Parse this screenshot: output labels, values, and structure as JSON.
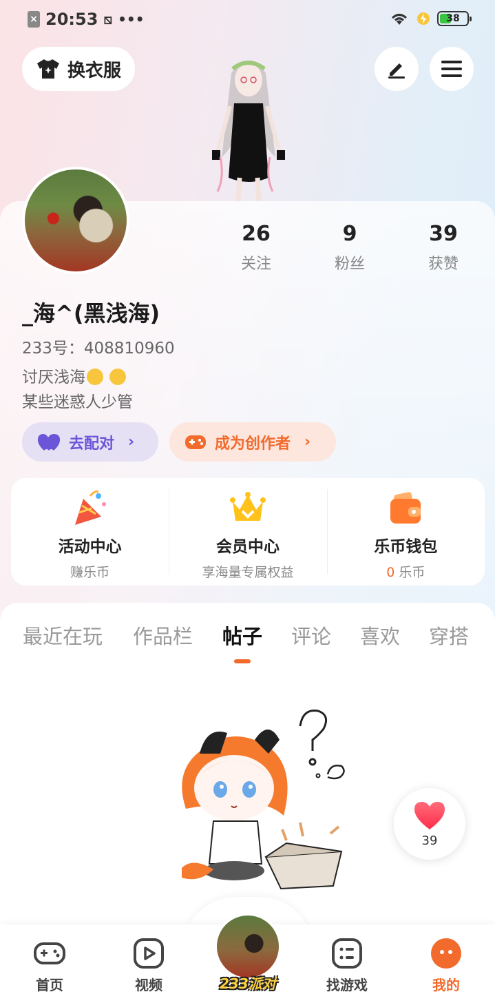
{
  "status_bar": {
    "time": "20:53",
    "battery": "38"
  },
  "header": {
    "outfit_label": "换衣服"
  },
  "stats": [
    {
      "value": "26",
      "label": "关注"
    },
    {
      "value": "9",
      "label": "粉丝"
    },
    {
      "value": "39",
      "label": "获赞"
    }
  ],
  "profile": {
    "username": "_海^(黑浅海)",
    "uid": "233号：408810960",
    "bio_line1": "讨厌浅海",
    "bio_line2": "某些迷惑人少管"
  },
  "actions": {
    "match_label": "去配对",
    "creator_label": "成为创作者"
  },
  "quick": [
    {
      "title": "活动中心",
      "sub": "赚乐币"
    },
    {
      "title": "会员中心",
      "sub": "享海量专属权益"
    },
    {
      "title": "乐币钱包",
      "coin": "0",
      "sub_suffix": " 乐币"
    }
  ],
  "tabs": [
    "最近在玩",
    "作品栏",
    "帖子",
    "评论",
    "喜欢",
    "穿搭"
  ],
  "active_tab": "帖子",
  "like_count": "39",
  "nav": {
    "home": "首页",
    "video": "视频",
    "party": "233派对",
    "games": "找游戏",
    "mine": "我的"
  },
  "colors": {
    "accent": "#f26a2c",
    "purple": "#6b55d8"
  }
}
